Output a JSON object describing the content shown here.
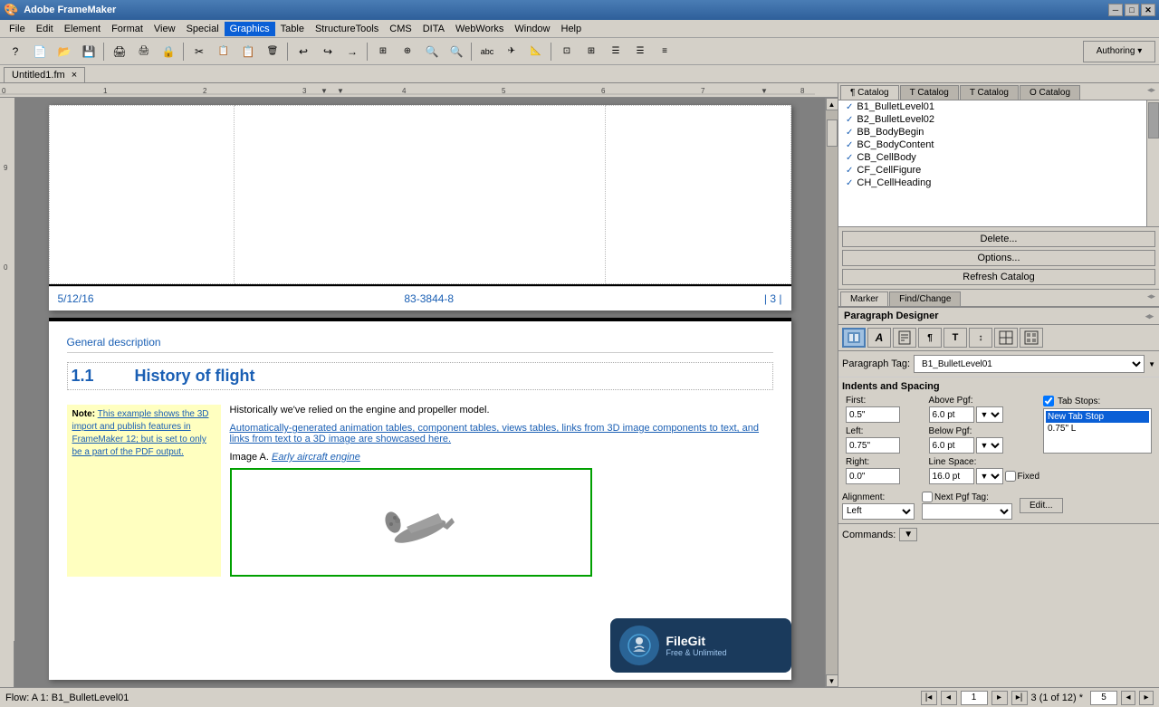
{
  "titlebar": {
    "app_icon": "fm-icon",
    "title": "Adobe FrameMaker",
    "minimize": "─",
    "maximize": "□",
    "close": "✕"
  },
  "menubar": {
    "items": [
      "File",
      "Edit",
      "Element",
      "Format",
      "View",
      "Special",
      "Graphics",
      "Table",
      "StructureTools",
      "CMS",
      "DITA",
      "WebWorks",
      "Window",
      "Help"
    ]
  },
  "toolbar": {
    "buttons": [
      "?",
      "📄",
      "📂",
      "💾",
      "🖨",
      "🖨",
      "🔒",
      "✂",
      "✂",
      "📋",
      "🗑",
      "↩",
      "↪",
      "→",
      "⊞",
      "⊕",
      "🔍",
      "🔍",
      "abc",
      "✈",
      "📐",
      "⊡",
      "⊞",
      "☰",
      "☰",
      "≡"
    ]
  },
  "doc_tab": {
    "label": "Untitled1.fm",
    "close": "×"
  },
  "ruler": {
    "marks": [
      "0",
      "1",
      "2",
      "3",
      "4",
      "5",
      "6",
      "7",
      "8"
    ]
  },
  "page1": {
    "footer_date": "5/12/16",
    "footer_code": "83-3844-8",
    "footer_page": "| 3 |"
  },
  "page2": {
    "section_heading": "General description",
    "chapter_number": "1.1",
    "chapter_title": "History of flight",
    "body_text": "Historically we've relied on the engine and propeller model.",
    "note_label": "Note:",
    "note_text": "This example shows the 3D import and publish features in FrameMaker 12; but is set to only be a part of the PDF output.",
    "linked_text": "Automatically-generated animation tables, component tables, views tables, links from 3D image components to text, and links from text to a 3D image are showcased here.",
    "image_caption_prefix": "Image A.",
    "image_caption_link": "Early aircraft engine"
  },
  "right_panel": {
    "catalog_tabs": [
      {
        "label": "¶ Catalog",
        "active": true
      },
      {
        "label": "T Catalog",
        "active": false
      },
      {
        "label": "T Catalog",
        "active": false
      },
      {
        "label": "O Catalog",
        "active": false
      }
    ],
    "catalog_items": [
      {
        "check": "✓",
        "name": "B1_BulletLevel01",
        "selected": false
      },
      {
        "check": "✓",
        "name": "B2_BulletLevel02",
        "selected": false
      },
      {
        "check": "✓",
        "name": "BB_BodyBegin",
        "selected": false
      },
      {
        "check": "✓",
        "name": "BC_BodyContent",
        "selected": false
      },
      {
        "check": "✓",
        "name": "CB_CellBody",
        "selected": false
      },
      {
        "check": "✓",
        "name": "CF_CellFigure",
        "selected": false
      },
      {
        "check": "✓",
        "name": "CH_CellHeading",
        "selected": false
      }
    ],
    "btn_delete": "Delete...",
    "btn_options": "Options...",
    "btn_refresh": "Refresh Catalog",
    "marker_tab": "Marker",
    "find_change_tab": "Find/Change",
    "para_designer_label": "Paragraph Designer",
    "para_toolbar_items": [
      "A",
      "A",
      "≡",
      "¶",
      "T",
      "↕",
      "⊞",
      "⊠"
    ],
    "para_tag_label": "Paragraph Tag:",
    "para_tag_value": "B1_BulletLevel01",
    "indents_title": "Indents and Spacing",
    "first_label": "First:",
    "first_value": "0.5\"",
    "above_pgf_label": "Above Pgf:",
    "above_pgf_value": "6.0 pt",
    "left_label": "Left:",
    "left_value": "0.75\"",
    "below_pgf_label": "Below Pgf:",
    "below_pgf_value": "6.0 pt",
    "right_label": "Right:",
    "right_value": "0.0\"",
    "line_space_label": "Line Space:",
    "line_space_value": "16.0 pt",
    "fixed_label": "Fixed",
    "tab_stops_label": "Tab Stops:",
    "tab_stop_new": "New Tab Stop",
    "tab_stop_075": "0.75\" L",
    "alignment_label": "Alignment:",
    "alignment_value": "Left",
    "next_pgf_tag_label": "Next Pgf Tag:",
    "next_pgf_tag_value": "",
    "edit_btn": "Edit...",
    "commands_label": "Commands:",
    "page_num_input": "1",
    "page_count": "3 (1 of 12) *",
    "zoom_value": "5"
  },
  "status_bar": {
    "flow": "Flow: A 1: B1_BulletLevel01"
  },
  "filegit": {
    "name": "FileGit",
    "sub": "Free & Unlimited"
  }
}
